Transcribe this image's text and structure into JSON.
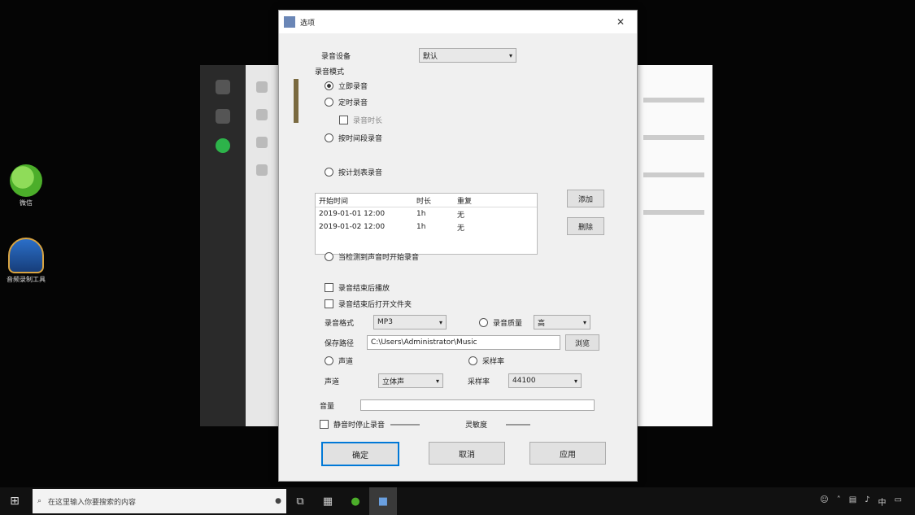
{
  "desktop": {
    "icons": [
      {
        "label": "微信"
      },
      {
        "label": "音频录制工具"
      }
    ]
  },
  "dialog": {
    "title": "选项",
    "device_label": "录音设备",
    "device_value": "默认",
    "mode_label": "录音模式",
    "options": [
      {
        "label": "立即录音",
        "checked": true
      },
      {
        "label": "定时录音",
        "checked": false
      },
      {
        "label": "按时间段录音",
        "checked": false
      },
      {
        "label": "按计划表录音",
        "checked": false
      },
      {
        "label": "当检测到声音时开始录音",
        "checked": false
      }
    ],
    "sub_option_text": "录音时长",
    "table": {
      "headers": [
        "开始时间",
        "时长",
        "重复"
      ],
      "rows": [
        [
          "2019-01-01 12:00",
          "1h",
          "无"
        ],
        [
          "2019-01-02 12:00",
          "1h",
          "无"
        ]
      ]
    },
    "add_button": "添加",
    "remove_button": "删除",
    "check_options": [
      "录音结束后播放",
      "录音结束后打开文件夹"
    ],
    "format_label": "录音格式",
    "format_value": "MP3",
    "quality_label": "录音质量",
    "quality_value": "高",
    "save_label": "保存路径",
    "save_path": "C:\\Users\\Administrator\\Music",
    "browse_button": "浏览",
    "channel_label": "声道",
    "channel_value": "立体声",
    "rate_label": "采样率",
    "rate_value": "44100",
    "volume_label": "音量",
    "auto_stop_label": "静音时停止录音",
    "sensitivity_label": "灵敏度",
    "ok_button": "确定",
    "cancel_button": "取消",
    "apply_button": "应用"
  },
  "taskbar": {
    "search_placeholder": "在这里输入你要搜索的内容"
  }
}
